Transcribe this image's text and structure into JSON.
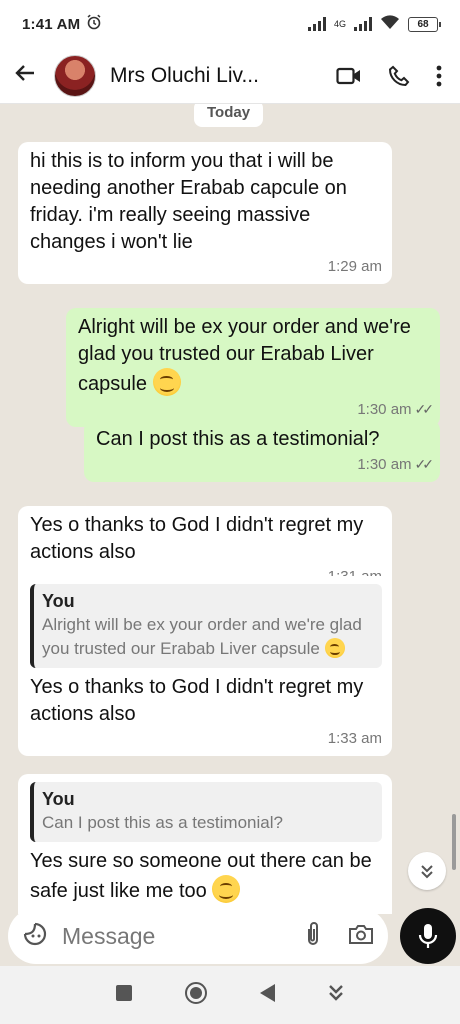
{
  "status_bar": {
    "time": "1:41 AM",
    "network_label": "4G",
    "battery": "68"
  },
  "header": {
    "contact_name": "Mrs Oluchi Liv...",
    "icons": [
      "back-arrow-icon",
      "video-call-icon",
      "phone-icon",
      "more-vert-icon"
    ]
  },
  "chat": {
    "date_chip": "Today",
    "messages": [
      {
        "direction": "in",
        "text": "hi this is to inform you that i will be needing another Erabab capcule on friday. i'm really seeing massive changes i won't lie",
        "time": "1:29 am"
      },
      {
        "direction": "out",
        "text": "Alright will be ex your order and we're glad you trusted our Erabab Liver capsule",
        "emoji": "smiling-face",
        "time": "1:30 am",
        "status": "read"
      },
      {
        "direction": "out",
        "text": "Can I post this as a testimonial?",
        "time": "1:30 am",
        "status": "read"
      },
      {
        "direction": "in",
        "text": "Yes o thanks to God I didn't regret my actions also",
        "time": "1:31 am"
      },
      {
        "direction": "in",
        "quote_author": "You",
        "quote_text": "Alright will be ex your order and we're glad you trusted our Erabab Liver capsule",
        "text": "Yes o thanks to God I didn't regret my actions also",
        "time": "1:33 am"
      },
      {
        "direction": "in",
        "quote_author": "You",
        "quote_text": "Can I post this as a testimonial?",
        "text": "Yes sure so someone out there can be safe just like me too",
        "emoji": "tears-of-joy"
      }
    ]
  },
  "composer": {
    "placeholder": "Message",
    "icons": [
      "sticker-icon",
      "attach-icon",
      "camera-icon",
      "mic-icon"
    ]
  },
  "nav": [
    "recent-apps-icon",
    "home-icon",
    "back-icon",
    "assistant-icon"
  ],
  "colors": {
    "chat_bg": "#e9e4dc",
    "incoming": "#ffffff",
    "outgoing": "#d7f8c4"
  }
}
